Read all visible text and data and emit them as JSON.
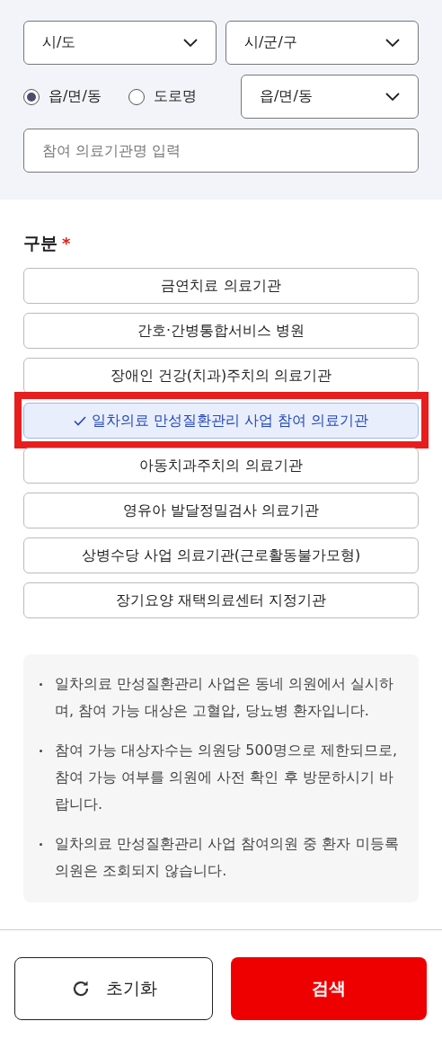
{
  "filters": {
    "selects_top": [
      {
        "label": "시/도"
      },
      {
        "label": "시/군/구"
      }
    ],
    "address_types": [
      {
        "label": "읍/면/동",
        "selected": true
      },
      {
        "label": "도로명",
        "selected": false
      }
    ],
    "select_dong": {
      "label": "읍/면/동"
    },
    "search": {
      "placeholder": "참여 의료기관명 입력"
    }
  },
  "category": {
    "title": "구분",
    "required_mark": "*",
    "options": [
      {
        "label": "금연치료 의료기관",
        "selected": false
      },
      {
        "label": "간호·간병통합서비스 병원",
        "selected": false
      },
      {
        "label": "장애인 건강(치과)주치의 의료기관",
        "selected": false
      },
      {
        "label": "일차의료 만성질환관리 사업 참여 의료기관",
        "selected": true
      },
      {
        "label": "아동치과주치의 의료기관",
        "selected": false
      },
      {
        "label": "영유아 발달정밀검사 의료기관",
        "selected": false
      },
      {
        "label": "상병수당 사업 의료기관(근로활동불가모형)",
        "selected": false
      },
      {
        "label": "장기요양 재택의료센터 지정기관",
        "selected": false
      }
    ]
  },
  "notes": [
    "일차의료 만성질환관리 사업은 동네 의원에서 실시하며, 참여 가능 대상은 고혈압, 당뇨병 환자입니다.",
    "참여 가능 대상자수는 의원당 500명으로 제한되므로, 참여 가능 여부를 의원에 사전 확인 후 방문하시기 바랍니다.",
    "일차의료 만성질환관리 사업 참여의원 중 환자 미등록 의원은 조회되지 않습니다."
  ],
  "buttons": {
    "reset": "초기화",
    "search": "검색"
  }
}
